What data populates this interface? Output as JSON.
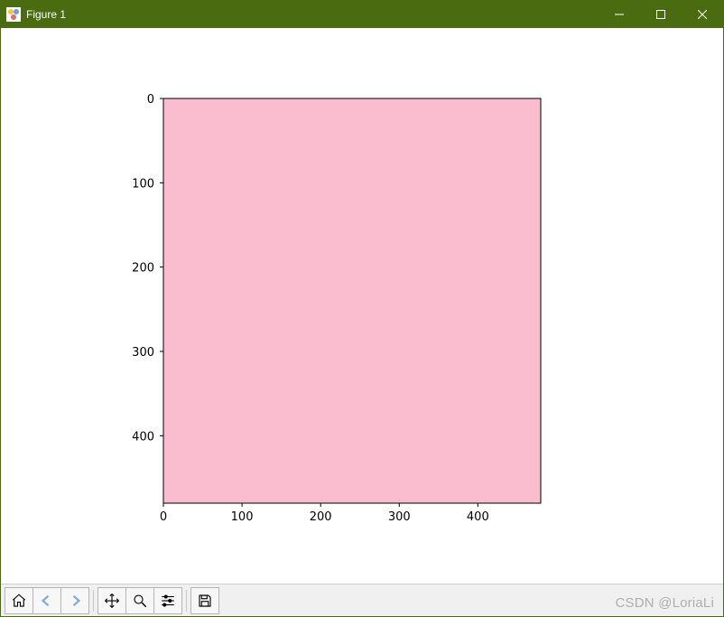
{
  "window": {
    "title": "Figure 1"
  },
  "chart_data": {
    "type": "heatmap",
    "title": "",
    "xlabel": "",
    "ylabel": "",
    "xlim": [
      0,
      480
    ],
    "ylim": [
      480,
      0
    ],
    "x_ticks": [
      0,
      100,
      200,
      300,
      400
    ],
    "y_ticks": [
      0,
      100,
      200,
      300,
      400
    ],
    "fill_color": "#fabccf",
    "description": "Uniform solid pink image displayed on image axes (origin top-left)"
  },
  "toolbar": {
    "home": "Home",
    "back": "Back",
    "forward": "Forward",
    "pan": "Pan",
    "zoom": "Zoom",
    "configure": "Configure subplots",
    "save": "Save"
  },
  "watermark": "CSDN @LoriaLi"
}
